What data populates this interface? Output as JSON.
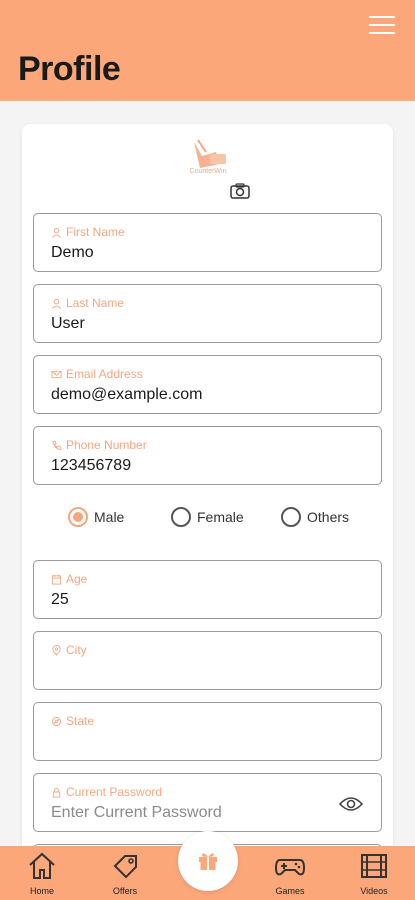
{
  "header": {
    "title": "Profile"
  },
  "logo": {
    "text": "CounterWin"
  },
  "fields": {
    "first_name": {
      "label": "First Name",
      "value": "Demo"
    },
    "last_name": {
      "label": "Last Name",
      "value": "User"
    },
    "email": {
      "label": "Email Address",
      "value": "demo@example.com"
    },
    "phone": {
      "label": "Phone Number",
      "value": "123456789"
    },
    "age": {
      "label": "Age",
      "value": "25"
    },
    "city": {
      "label": "City",
      "value": ""
    },
    "state": {
      "label": "State",
      "value": ""
    },
    "current_password": {
      "label": "Current Password",
      "placeholder": "Enter Current Password"
    }
  },
  "gender": {
    "options": [
      "Male",
      "Female",
      "Others"
    ],
    "selected": "Male"
  },
  "bottom_nav": {
    "home": "Home",
    "offers": "Offers",
    "games": "Games",
    "videos": "Videos"
  },
  "colors": {
    "accent": "#fba77a",
    "label": "#f6a67e"
  }
}
